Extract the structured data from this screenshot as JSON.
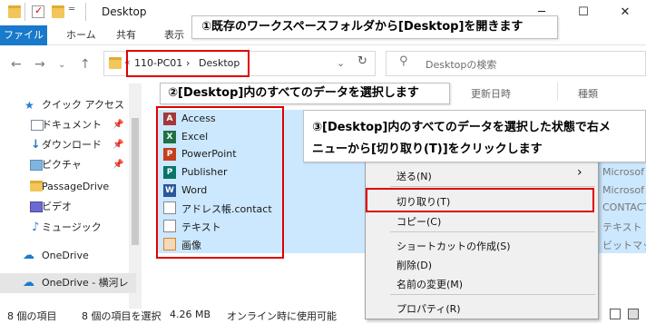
{
  "window": {
    "title": "Desktop"
  },
  "window_controls": {
    "minimize": "─",
    "maximize": "☐",
    "close": "✕"
  },
  "ribbon": {
    "file_tab": "ファイル",
    "tabs": [
      "ホーム",
      "共有",
      "表示"
    ]
  },
  "address": {
    "overflow": "«",
    "path": [
      "110-PC01",
      "Desktop"
    ],
    "separator": "›",
    "dropdown": "⌄",
    "refresh": "↻"
  },
  "search": {
    "placeholder": "Desktopの検索"
  },
  "nav": {
    "items": [
      {
        "label": "クイック アクセス"
      },
      {
        "label": "ドキュメント"
      },
      {
        "label": "ダウンロード"
      },
      {
        "label": "ピクチャ"
      },
      {
        "label": "PassageDrive"
      },
      {
        "label": "ビデオ"
      },
      {
        "label": "ミュージック"
      },
      {
        "label": "OneDrive"
      },
      {
        "label": "OneDrive - 横河レ"
      }
    ]
  },
  "columns": {
    "date": "更新日時",
    "type": "種類"
  },
  "files": [
    {
      "name": "Access",
      "icon_letter": "A",
      "color": "#a4373a"
    },
    {
      "name": "Excel",
      "icon_letter": "X",
      "color": "#1e7145"
    },
    {
      "name": "PowerPoint",
      "icon_letter": "P",
      "color": "#c43e1c"
    },
    {
      "name": "Publisher",
      "icon_letter": "P",
      "color": "#077568"
    },
    {
      "name": "Word",
      "icon_letter": "W",
      "color": "#2b579a"
    },
    {
      "name": "アドレス帳.contact",
      "icon_letter": "",
      "color": "#777777"
    },
    {
      "name": "テキスト",
      "icon_letter": "",
      "color": "#777777"
    },
    {
      "name": "画像",
      "icon_letter": "",
      "color": "#d9822b"
    }
  ],
  "right_column": [
    "Microsof",
    "Microsof",
    "CONTACT",
    "テキスト ド",
    "ビットマップ"
  ],
  "context_menu": {
    "items": [
      "送る(N)",
      "切り取り(T)",
      "コピー(C)",
      "ショートカットの作成(S)",
      "削除(D)",
      "名前の変更(M)",
      "プロパティ(R)"
    ],
    "arrow": "›"
  },
  "callouts": {
    "c1": "①既存のワークスペースフォルダから[Desktop]を開きます",
    "c2": "②[Desktop]内のすべてのデータを選択します",
    "c3_line1": "③[Desktop]内のすべてのデータを選択した状態で右メ",
    "c3_line2": "ニューから[切り取り(T)]をクリックします"
  },
  "status": {
    "count": "8 個の項目",
    "selected": "8 個の項目を選択",
    "size": "4.26 MB",
    "availability": "オンライン時に使用可能"
  },
  "colors": {
    "accent": "#1979ca",
    "selection": "#cce8ff",
    "highlight": "#e00000"
  }
}
